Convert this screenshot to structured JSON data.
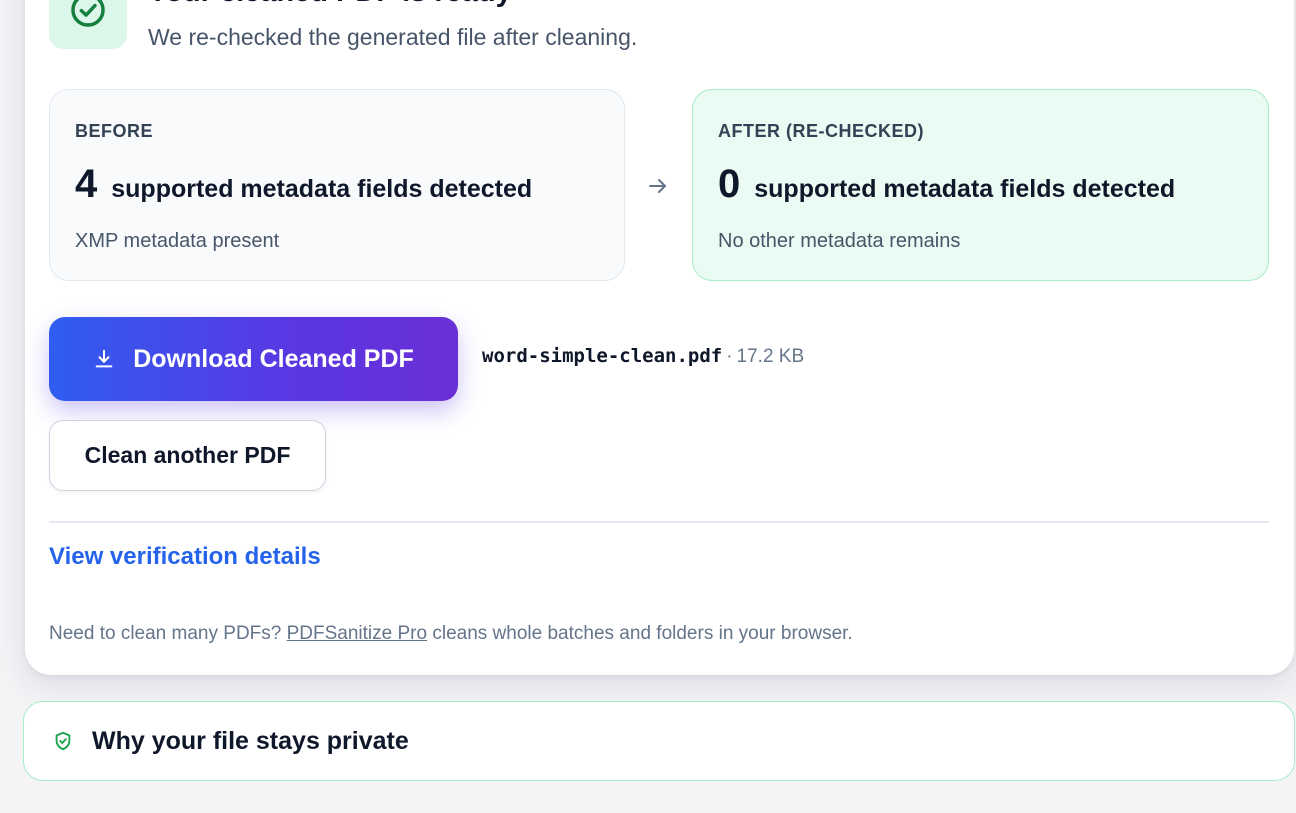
{
  "header": {
    "title": "Your cleaned PDF is ready",
    "subtitle": "We re-checked the generated file after cleaning."
  },
  "before": {
    "label": "BEFORE",
    "count": "4",
    "count_text": "supported metadata fields detected",
    "note": "XMP metadata present"
  },
  "after": {
    "label": "AFTER (RE-CHECKED)",
    "count": "0",
    "count_text": "supported metadata fields detected",
    "note": "No other metadata remains"
  },
  "actions": {
    "download_label": "Download Cleaned PDF",
    "file_name": "word-simple-clean.pdf",
    "file_separator": "·",
    "file_size": "17.2 KB",
    "clean_another_label": "Clean another PDF"
  },
  "verification": {
    "link_label": "View verification details"
  },
  "promo": {
    "prefix": "Need to clean many PDFs?",
    "link": "PDFSanitize Pro",
    "suffix": "cleans whole batches and folders in your browser."
  },
  "privacy": {
    "title": "Why your file stays private"
  },
  "colors": {
    "accent_green": "#16a34a",
    "link_blue": "#2563eb",
    "gradient_start": "#2f5df0",
    "gradient_end": "#6a2fd6"
  },
  "icons": {
    "status": "check-circle-icon",
    "arrow": "arrow-right-icon",
    "download": "download-icon",
    "privacy": "shield-check-icon"
  }
}
